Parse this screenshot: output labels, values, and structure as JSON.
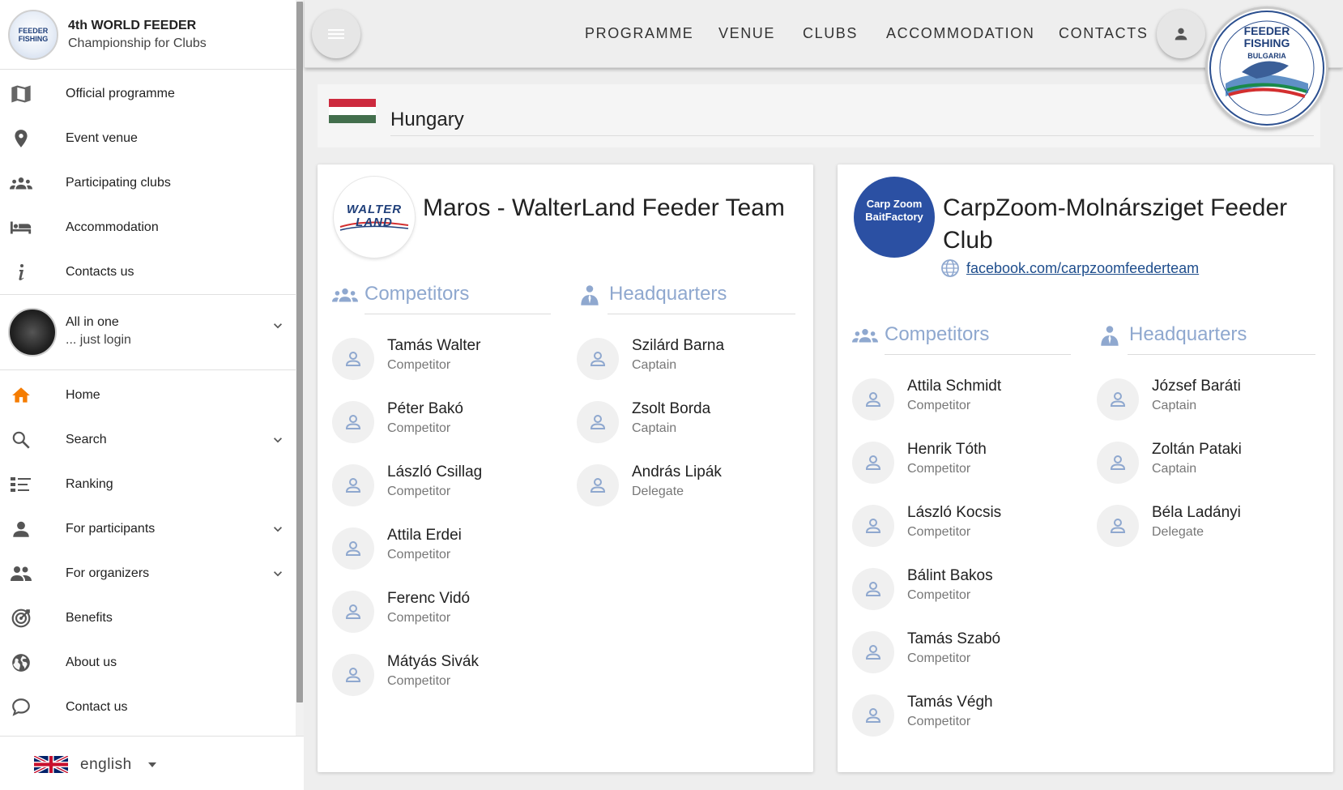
{
  "sidebar": {
    "brand": {
      "title": "4th WORLD FEEDER",
      "subtitle": "Championship for Clubs",
      "logo_text": "FEEDER FISHING"
    },
    "main_items": [
      {
        "label": "Official programme",
        "icon": "map-book-icon"
      },
      {
        "label": "Event venue",
        "icon": "location-pin-icon"
      },
      {
        "label": "Participating clubs",
        "icon": "group-icon"
      },
      {
        "label": "Accommodation",
        "icon": "bed-icon"
      },
      {
        "label": "Contacts us",
        "icon": "info-icon"
      }
    ],
    "user": {
      "line1": "All in one",
      "line2": "... just login"
    },
    "secondary_items": [
      {
        "label": "Home",
        "icon": "home-icon"
      },
      {
        "label": "Search",
        "icon": "search-icon"
      },
      {
        "label": "Ranking",
        "icon": "list-icon"
      },
      {
        "label": "For participants",
        "icon": "person-icon"
      },
      {
        "label": "For organizers",
        "icon": "people-icon"
      },
      {
        "label": "Benefits",
        "icon": "target-icon"
      },
      {
        "label": "About us",
        "icon": "globe-icon"
      },
      {
        "label": "Contact us",
        "icon": "chat-bubble-icon"
      }
    ],
    "language": "english"
  },
  "topbar": {
    "nav": [
      "PROGRAMME",
      "VENUE",
      "CLUBS",
      "ACCOMMODATION",
      "CONTACTS"
    ],
    "event_logo": {
      "line1": "FEEDER",
      "line2": "FISHING",
      "line3": "BULGARIA"
    }
  },
  "country": {
    "name": "Hungary"
  },
  "sections": {
    "competitors": "Competitors",
    "headquarters": "Headquarters"
  },
  "clubs": [
    {
      "name": "Maros - WalterLand Feeder Team",
      "logo_text": "WALTER LAND",
      "link": "",
      "competitors": [
        {
          "name": "Tamás Walter",
          "role": "Competitor"
        },
        {
          "name": "Péter Bakó",
          "role": "Competitor"
        },
        {
          "name": "László Csillag",
          "role": "Competitor"
        },
        {
          "name": "Attila Erdei",
          "role": "Competitor"
        },
        {
          "name": "Ferenc Vidó",
          "role": "Competitor"
        },
        {
          "name": "Mátyás Sivák",
          "role": "Competitor"
        }
      ],
      "headquarters": [
        {
          "name": "Szilárd Barna",
          "role": "Captain"
        },
        {
          "name": "Zsolt Borda",
          "role": "Captain"
        },
        {
          "name": "András Lipák",
          "role": "Delegate"
        }
      ]
    },
    {
      "name": "CarpZoom-Molnársziget Feeder Club",
      "logo_text": "Carp Zoom BaitFactory",
      "link": "facebook.com/carpzoomfeederteam",
      "competitors": [
        {
          "name": "Attila Schmidt",
          "role": "Competitor"
        },
        {
          "name": "Henrik Tóth",
          "role": "Competitor"
        },
        {
          "name": "László Kocsis",
          "role": "Competitor"
        },
        {
          "name": "Bálint Bakos",
          "role": "Competitor"
        },
        {
          "name": "Tamás Szabó",
          "role": "Competitor"
        },
        {
          "name": "Tamás Végh",
          "role": "Competitor"
        }
      ],
      "headquarters": [
        {
          "name": "József Baráti",
          "role": "Captain"
        },
        {
          "name": "Zoltán Pataki",
          "role": "Captain"
        },
        {
          "name": "Béla Ladányi",
          "role": "Delegate"
        }
      ]
    }
  ],
  "colors": {
    "accent_orange": "#f57c00",
    "section_blue": "#8fa8cf",
    "icon_grey": "#555555",
    "link_blue": "#1e4d8c",
    "club2_blue": "#2b50a3"
  }
}
